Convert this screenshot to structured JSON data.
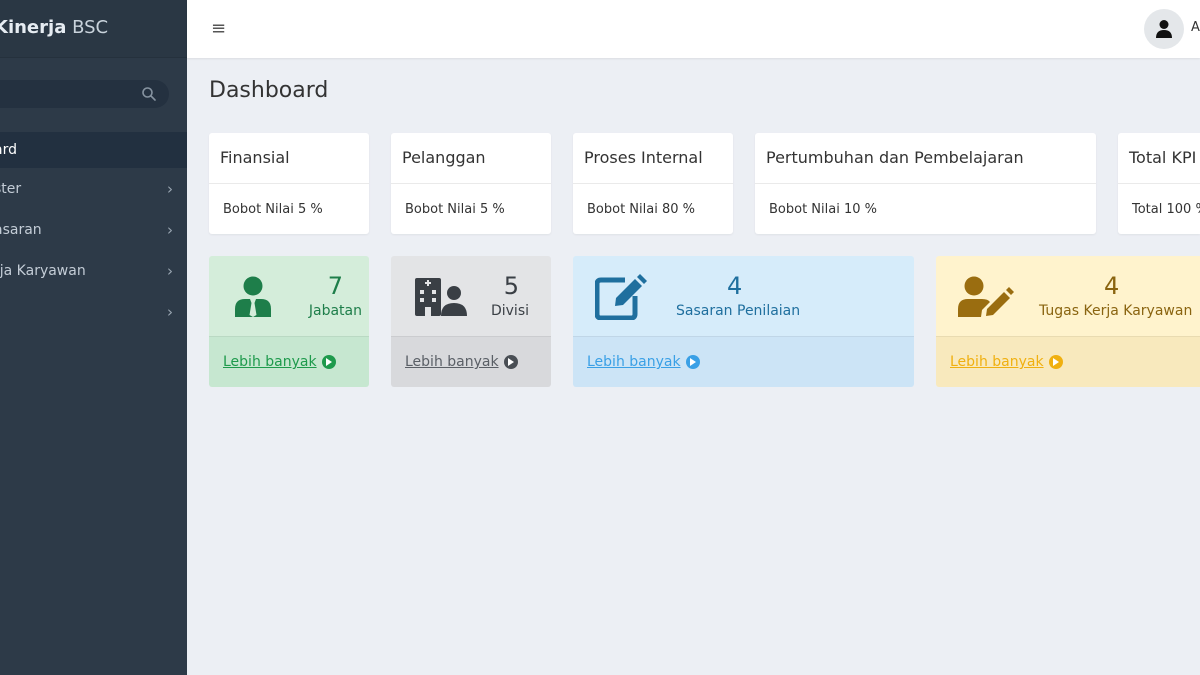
{
  "app": {
    "brand_bold": "Kinerja",
    "brand_light": " BSC"
  },
  "sidebar": {
    "items": [
      {
        "label": "ard",
        "has_submenu": false,
        "active": true
      },
      {
        "label": "ster",
        "has_submenu": true
      },
      {
        "label": "asaran",
        "has_submenu": true
      },
      {
        "label": "rja Karyawan",
        "has_submenu": true
      },
      {
        "label": "",
        "has_submenu": true
      }
    ],
    "chevron": "›"
  },
  "topbar": {
    "menu_icon": "≡",
    "user_label": "A"
  },
  "page": {
    "title": "Dashboard"
  },
  "bsc": [
    {
      "title": "Finansial",
      "value": "Bobot Nilai 5 %"
    },
    {
      "title": "Pelanggan",
      "value": "Bobot Nilai 5 %"
    },
    {
      "title": "Proses Internal",
      "value": "Bobot Nilai 80 %"
    },
    {
      "title": "Pertumbuhan dan Pembelajaran",
      "value": "Bobot Nilai 10 %"
    },
    {
      "title": "Total KPI",
      "value": "Total 100 %"
    }
  ],
  "tiles": [
    {
      "number": "7",
      "label": "Jabatan",
      "link": "Lebih banyak",
      "icon": "user-tie-icon",
      "color": "#1e7e4a"
    },
    {
      "number": "5",
      "label": "Divisi",
      "link": "Lebih banyak",
      "icon": "hospital-user-icon",
      "color": "#3a3f45"
    },
    {
      "number": "4",
      "label": "Sasaran Penilaian",
      "link": "Lebih banyak",
      "icon": "edit-icon",
      "color": "#1f6f9e"
    },
    {
      "number": "4",
      "label": "Tugas Kerja Karyawan",
      "link": "Lebih banyak",
      "icon": "user-edit-icon",
      "color": "#9a6d10"
    }
  ],
  "colors": {
    "sidebar_bg": "#2d3a48",
    "page_bg": "#eceff4",
    "green_tile": "#d4edda",
    "gray_tile": "#dfe0e2",
    "blue_tile": "#d6ecfa",
    "yellow_tile": "#fff3cd",
    "green_link": "#1e9a4c",
    "gray_link": "#5a5f66",
    "blue_link": "#3aa0e6",
    "yellow_link": "#f0b010"
  }
}
